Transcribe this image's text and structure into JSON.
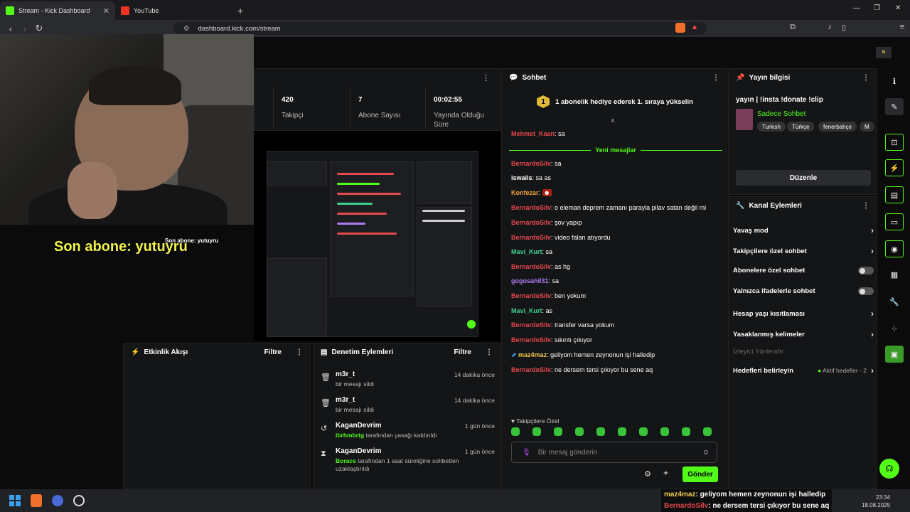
{
  "browser": {
    "tabs": [
      {
        "label": "Stream - Kick Dashboard"
      },
      {
        "label": "YouTube"
      }
    ],
    "url": "dashboard.kick.com/stream"
  },
  "overlay": {
    "last_sub": "Son abone: yutuyru",
    "last_sub_small": "Son abone: yutuyru"
  },
  "stats": {
    "followers": {
      "value": "420",
      "label": "Takipçi"
    },
    "subs": {
      "value": "7",
      "label": "Abone Sayısı"
    },
    "uptime": {
      "value": "00:02:55",
      "label": "Yayında Olduğu Süre"
    }
  },
  "chat": {
    "title": "Sohbet",
    "pinned_badge": "1",
    "pinned_text": "1 abonelik hediye ederek 1. sıraya yükselin",
    "new_messages": "Yeni mesajlar",
    "messages": [
      {
        "user": "Mehmet_Kaan",
        "text": ": sa",
        "color": "#e5484d"
      },
      {
        "user": "BernardoSilv",
        "text": ": sa",
        "color": "#e5484d"
      },
      {
        "user": "iswails",
        "text": ": sa as",
        "color": "#ffffff"
      },
      {
        "user": "Konfezar",
        "text": ": ",
        "color": "#f2a33a"
      },
      {
        "user": "BernardoSilv",
        "text": ": o eleman deprem zamanı parayla pilav satan değil mi",
        "color": "#e5484d"
      },
      {
        "user": "BernardoSilv",
        "text": ": şov yapıp",
        "color": "#e5484d"
      },
      {
        "user": "BernardoSilv",
        "text": ": video falan atıyordu",
        "color": "#e5484d"
      },
      {
        "user": "Mavi_Kurt",
        "text": ": sa",
        "color": "#3ecf8e"
      },
      {
        "user": "BernardoSilv",
        "text": ": as hg",
        "color": "#e5484d"
      },
      {
        "user": "gogosahil31",
        "text": ": sa",
        "color": "#b07cf5"
      },
      {
        "user": "BernardoSilv",
        "text": ": ben yokum",
        "color": "#e5484d"
      },
      {
        "user": "Mavi_Kurt",
        "text": ": as",
        "color": "#3ecf8e"
      },
      {
        "user": "BernardoSilv",
        "text": ": transfer varsa yokum",
        "color": "#e5484d"
      },
      {
        "user": "BernardoSilv",
        "text": ": sıkıntı çıkıyor",
        "color": "#e5484d"
      },
      {
        "user": "maz4maz",
        "text": ": geliyom hemen zeynonun işi halledip",
        "color": "#f2c94c"
      },
      {
        "user": "BernardoSilv",
        "text": ": ne dersem tersi çıkıyor bu sene aq",
        "color": "#e5484d"
      }
    ],
    "follower_only": "Takipçilere Özel",
    "input_placeholder": "Bir mesaj gönderin",
    "send": "Gönder"
  },
  "stream_info": {
    "header": "Yayın bilgisi",
    "title": "yayın | !insta !donate !clip",
    "category": "Sadece Sohbet",
    "tags": [
      "Turkish",
      "Türkçe",
      "fenerbahçe",
      "M"
    ],
    "edit": "Düzenle"
  },
  "channel_actions": {
    "header": "Kanal Eylemleri",
    "items": [
      "Yavaş mod",
      "Takipçilere özel sohbet",
      "Abonelere özel sohbet",
      "Yalnızca ifadelerle sohbet",
      "Hesap yaşı kısıtlaması",
      "Yasaklanmış kelimeler",
      "İzleyici Yönlendir",
      "Hedefleri belirleyin"
    ],
    "goals_status": "Aktif hedefler - 2"
  },
  "activity": {
    "header": "Etkinlik Akışı",
    "filter": "Filtre"
  },
  "modlog": {
    "header": "Denetim Eylemleri",
    "filter": "Filtre",
    "items": [
      {
        "name": "m3r_t",
        "time": "14 dakika önce",
        "desc": "bir mesajı sildi",
        "actor": "",
        "icon": "trash-icon"
      },
      {
        "name": "m3r_t",
        "time": "14 dakika önce",
        "desc": "bir mesajı sildi",
        "actor": "",
        "icon": "trash-icon"
      },
      {
        "name": "KaganDevrim",
        "time": "1 gün önce",
        "desc": " tarafından yasağı kaldırıldı",
        "actor": "ibrhmbrtg",
        "icon": "undo-icon"
      },
      {
        "name": "KaganDevrim",
        "time": "1 gün önce",
        "desc": " tarafından 1 saat süreliğine sohbetten uzaklaştırıldı",
        "actor": "Boracs",
        "icon": "hourglass-icon"
      }
    ]
  },
  "ticker": [
    {
      "user": "maz4maz",
      "text": ": geliyom hemen zeynonun işi halledip"
    },
    {
      "user": "BernardoSilv",
      "text": ": ne dersem tersi çıkıyor bu sene aq"
    }
  ],
  "clock": {
    "time": "23:34",
    "date": "18.08.2025"
  },
  "colors": {
    "accent": "#53fc18"
  }
}
